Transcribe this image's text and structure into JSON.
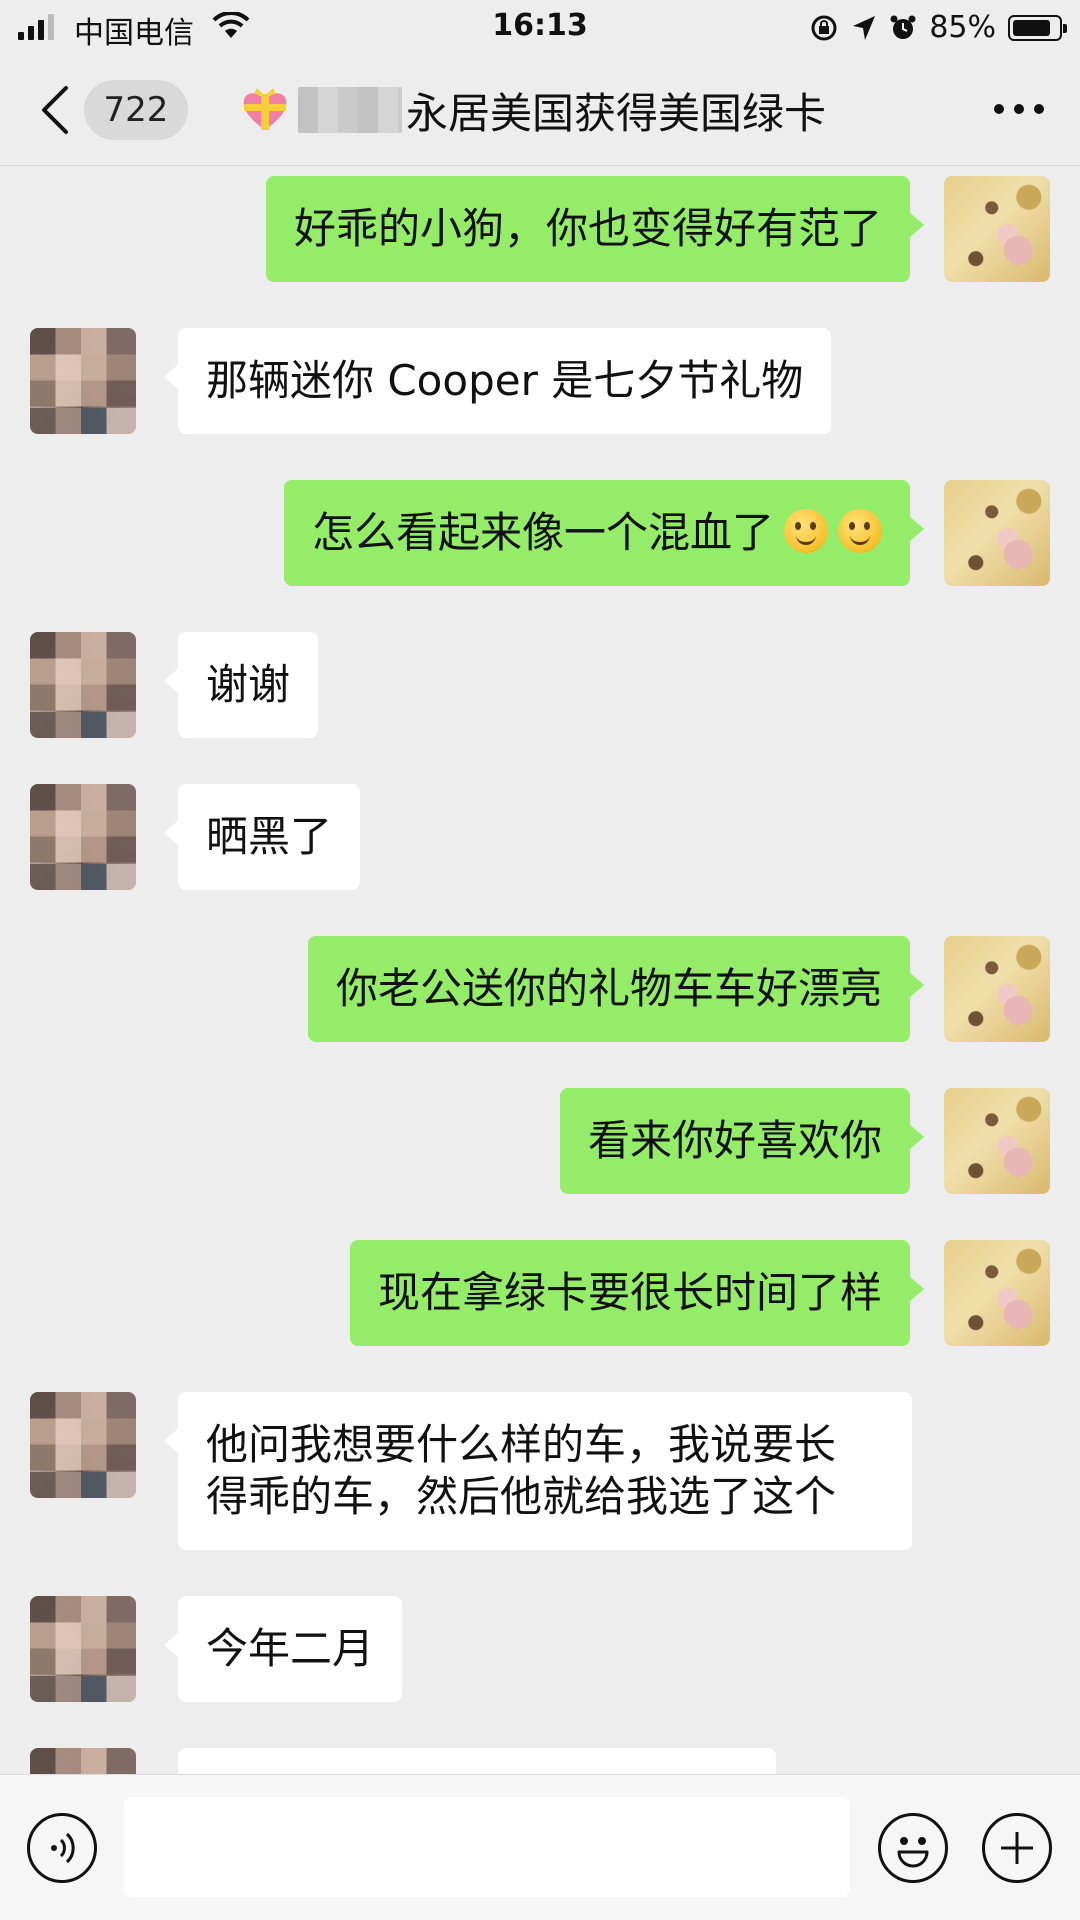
{
  "status_bar": {
    "carrier": "中国电信",
    "time": "16:13",
    "battery_percent": "85%",
    "battery_level": 0.85,
    "signal_bars": 3
  },
  "header": {
    "unread_count": "722",
    "title": "永居美国获得美国绿卡"
  },
  "messages": [
    {
      "side": "mine",
      "text": "好乖的小狗，你也变得好有范了"
    },
    {
      "side": "theirs",
      "text": "那辆迷你 Cooper 是七夕节礼物"
    },
    {
      "side": "mine",
      "text": "怎么看起来像一个混血了",
      "emoji_count": 2
    },
    {
      "side": "theirs",
      "text": "谢谢"
    },
    {
      "side": "theirs",
      "text": "晒黑了"
    },
    {
      "side": "mine",
      "text": "你老公送你的礼物车车好漂亮"
    },
    {
      "side": "mine",
      "text": "看来你好喜欢你"
    },
    {
      "side": "mine",
      "text": "现在拿绿卡要很长时间了样"
    },
    {
      "side": "theirs",
      "lines": [
        "他问我想要什么样的车，我说要长",
        "得乖的车，然后他就给我选了这个"
      ]
    },
    {
      "side": "theirs",
      "text": "今年二月"
    }
  ],
  "input_bar": {
    "placeholder": "",
    "icons": [
      "voice-icon",
      "emoji-icon",
      "plus-icon"
    ]
  },
  "colors": {
    "my_bubble": "#95ec69",
    "their_bubble": "#ffffff",
    "background": "#ededed"
  }
}
